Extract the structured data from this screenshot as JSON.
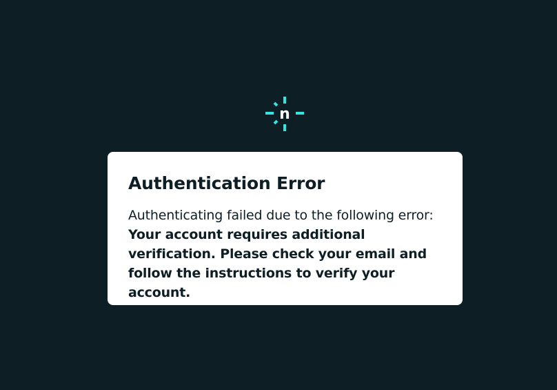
{
  "logo": {
    "letter": "n",
    "accent": "#32e6e2",
    "icon": "netlify-logo-icon"
  },
  "card": {
    "title": "Authentication Error",
    "intro": "Authenticating failed due to the following error:",
    "message": "Your account requires additional verification. Please check your email and follow the instructions to verify your account."
  },
  "colors": {
    "background": "#0e1e25",
    "card": "#ffffff",
    "text": "#0e1e25"
  }
}
